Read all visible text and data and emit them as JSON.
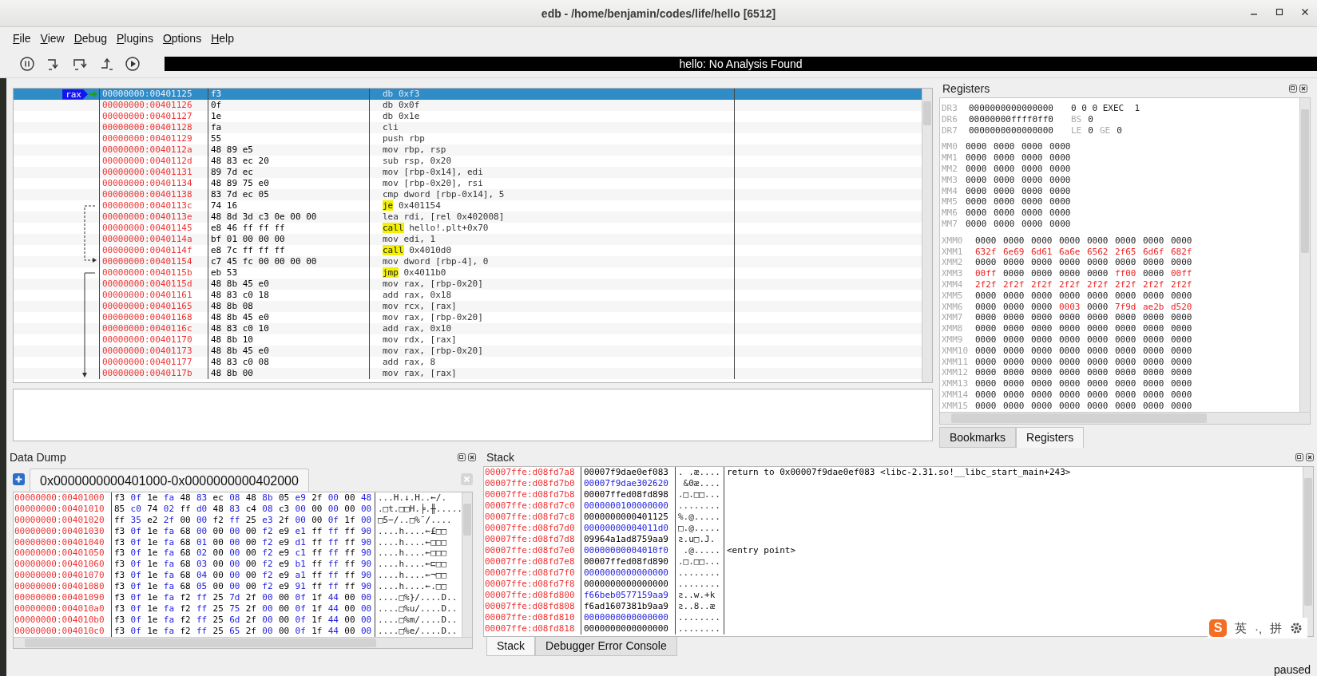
{
  "window": {
    "title": "edb - /home/benjamin/codes/life/hello [6512]"
  },
  "menu": [
    "File",
    "View",
    "Debug",
    "Plugins",
    "Options",
    "Help"
  ],
  "toolbar": {
    "status": "hello: No Analysis Found"
  },
  "disassembly": {
    "rows": [
      {
        "address": "00000000:00401125",
        "bytes": "f3",
        "mnemonic": "db",
        "operands": "0xf3",
        "kind": "data",
        "selected": true,
        "marker": "rax"
      },
      {
        "address": "00000000:00401126",
        "bytes": "0f",
        "mnemonic": "db",
        "operands": "0x0f",
        "kind": "data",
        "selected": false
      },
      {
        "address": "00000000:00401127",
        "bytes": "1e",
        "mnemonic": "db",
        "operands": "0x1e",
        "kind": "data",
        "selected": false
      },
      {
        "address": "00000000:00401128",
        "bytes": "fa",
        "mnemonic": "cli",
        "operands": "",
        "kind": "op",
        "selected": false
      },
      {
        "address": "00000000:00401129",
        "bytes": "55",
        "mnemonic": "push",
        "operands": "rbp",
        "kind": "op",
        "selected": false
      },
      {
        "address": "00000000:0040112a",
        "bytes": "48 89 e5",
        "mnemonic": "mov",
        "operands": "rbp, rsp",
        "kind": "op",
        "selected": false
      },
      {
        "address": "00000000:0040112d",
        "bytes": "48 83 ec 20",
        "mnemonic": "sub",
        "operands": "rsp, 0x20",
        "kind": "op",
        "selected": false
      },
      {
        "address": "00000000:00401131",
        "bytes": "89 7d ec",
        "mnemonic": "mov",
        "operands": "[rbp-0x14], edi",
        "kind": "op",
        "selected": false
      },
      {
        "address": "00000000:00401134",
        "bytes": "48 89 75 e0",
        "mnemonic": "mov",
        "operands": "[rbp-0x20], rsi",
        "kind": "op",
        "selected": false
      },
      {
        "address": "00000000:00401138",
        "bytes": "83 7d ec 05",
        "mnemonic": "cmp",
        "operands": "dword [rbp-0x14], 5",
        "kind": "op",
        "selected": false
      },
      {
        "address": "00000000:0040113c",
        "bytes": "74 16",
        "mnemonic": "je",
        "operands": "0x401154",
        "kind": "branch",
        "selected": false
      },
      {
        "address": "00000000:0040113e",
        "bytes": "48 8d 3d c3 0e 00 00",
        "mnemonic": "lea",
        "operands": "rdi, [rel 0x402008]",
        "kind": "op",
        "selected": false
      },
      {
        "address": "00000000:00401145",
        "bytes": "e8 46 ff ff ff",
        "mnemonic": "call",
        "operands": "hello!.plt+0x70",
        "kind": "branch",
        "selected": false
      },
      {
        "address": "00000000:0040114a",
        "bytes": "bf 01 00 00 00",
        "mnemonic": "mov",
        "operands": "edi, 1",
        "kind": "op",
        "selected": false
      },
      {
        "address": "00000000:0040114f",
        "bytes": "e8 7c ff ff ff",
        "mnemonic": "call",
        "operands": "0x4010d0",
        "kind": "branch",
        "selected": false
      },
      {
        "address": "00000000:00401154",
        "bytes": "c7 45 fc 00 00 00 00",
        "mnemonic": "mov",
        "operands": "dword [rbp-4], 0",
        "kind": "op",
        "selected": false
      },
      {
        "address": "00000000:0040115b",
        "bytes": "eb 53",
        "mnemonic": "jmp",
        "operands": "0x4011b0",
        "kind": "branch",
        "selected": false
      },
      {
        "address": "00000000:0040115d",
        "bytes": "48 8b 45 e0",
        "mnemonic": "mov",
        "operands": "rax, [rbp-0x20]",
        "kind": "op",
        "selected": false
      },
      {
        "address": "00000000:00401161",
        "bytes": "48 83 c0 18",
        "mnemonic": "add",
        "operands": "rax, 0x18",
        "kind": "op",
        "selected": false
      },
      {
        "address": "00000000:00401165",
        "bytes": "48 8b 08",
        "mnemonic": "mov",
        "operands": "rcx, [rax]",
        "kind": "op",
        "selected": false
      },
      {
        "address": "00000000:00401168",
        "bytes": "48 8b 45 e0",
        "mnemonic": "mov",
        "operands": "rax, [rbp-0x20]",
        "kind": "op",
        "selected": false
      },
      {
        "address": "00000000:0040116c",
        "bytes": "48 83 c0 10",
        "mnemonic": "add",
        "operands": "rax, 0x10",
        "kind": "op",
        "selected": false
      },
      {
        "address": "00000000:00401170",
        "bytes": "48 8b 10",
        "mnemonic": "mov",
        "operands": "rdx, [rax]",
        "kind": "op",
        "selected": false
      },
      {
        "address": "00000000:00401173",
        "bytes": "48 8b 45 e0",
        "mnemonic": "mov",
        "operands": "rax, [rbp-0x20]",
        "kind": "op",
        "selected": false
      },
      {
        "address": "00000000:00401177",
        "bytes": "48 83 c0 08",
        "mnemonic": "add",
        "operands": "rax, 8",
        "kind": "op",
        "selected": false
      },
      {
        "address": "00000000:0040117b",
        "bytes": "48 8b 00",
        "mnemonic": "mov",
        "operands": "rax, [rax]",
        "kind": "op",
        "selected": false
      }
    ]
  },
  "registers": {
    "title": "Registers",
    "debug": [
      {
        "name": "DR3",
        "value": "0000000000000000",
        "extra": "0 0 0 EXEC  1"
      },
      {
        "name": "DR6",
        "value": "00000000ffff0ff0",
        "flags": [
          {
            "label": "BS",
            "value": "0"
          }
        ]
      },
      {
        "name": "DR7",
        "value": "0000000000000000",
        "flags": [
          {
            "label": "LE",
            "value": "0"
          },
          {
            "label": "GE",
            "value": "0"
          }
        ]
      }
    ],
    "mmx": [
      {
        "name": "MM0",
        "values": [
          "0000",
          "0000",
          "0000",
          "0000"
        ]
      },
      {
        "name": "MM1",
        "values": [
          "0000",
          "0000",
          "0000",
          "0000"
        ]
      },
      {
        "name": "MM2",
        "values": [
          "0000",
          "0000",
          "0000",
          "0000"
        ]
      },
      {
        "name": "MM3",
        "values": [
          "0000",
          "0000",
          "0000",
          "0000"
        ]
      },
      {
        "name": "MM4",
        "values": [
          "0000",
          "0000",
          "0000",
          "0000"
        ]
      },
      {
        "name": "MM5",
        "values": [
          "0000",
          "0000",
          "0000",
          "0000"
        ]
      },
      {
        "name": "MM6",
        "values": [
          "0000",
          "0000",
          "0000",
          "0000"
        ]
      },
      {
        "name": "MM7",
        "values": [
          "0000",
          "0000",
          "0000",
          "0000"
        ]
      }
    ],
    "xmm": [
      {
        "name": "XMM0",
        "values": [
          "0000",
          "0000",
          "0000",
          "0000",
          "0000",
          "0000",
          "0000",
          "0000"
        ]
      },
      {
        "name": "XMM1",
        "values": [
          "632f",
          "6e69",
          "6d61",
          "6a6e",
          "6562",
          "2f65",
          "6d6f",
          "682f"
        ],
        "changed": [
          true,
          true,
          true,
          true,
          true,
          true,
          true,
          true
        ]
      },
      {
        "name": "XMM2",
        "values": [
          "0000",
          "0000",
          "0000",
          "0000",
          "0000",
          "0000",
          "0000",
          "0000"
        ]
      },
      {
        "name": "XMM3",
        "values": [
          "00ff",
          "0000",
          "0000",
          "0000",
          "0000",
          "ff00",
          "0000",
          "00ff"
        ],
        "changed": [
          true,
          false,
          false,
          false,
          false,
          true,
          false,
          true
        ]
      },
      {
        "name": "XMM4",
        "values": [
          "2f2f",
          "2f2f",
          "2f2f",
          "2f2f",
          "2f2f",
          "2f2f",
          "2f2f",
          "2f2f"
        ],
        "changed": [
          true,
          true,
          true,
          true,
          true,
          true,
          true,
          true
        ]
      },
      {
        "name": "XMM5",
        "values": [
          "0000",
          "0000",
          "0000",
          "0000",
          "0000",
          "0000",
          "0000",
          "0000"
        ]
      },
      {
        "name": "XMM6",
        "values": [
          "0000",
          "0000",
          "0000",
          "0003",
          "0000",
          "7f9d",
          "ae2b",
          "d520"
        ],
        "changed": [
          false,
          false,
          false,
          true,
          false,
          true,
          true,
          true
        ]
      },
      {
        "name": "XMM7",
        "values": [
          "0000",
          "0000",
          "0000",
          "0000",
          "0000",
          "0000",
          "0000",
          "0000"
        ]
      },
      {
        "name": "XMM8",
        "values": [
          "0000",
          "0000",
          "0000",
          "0000",
          "0000",
          "0000",
          "0000",
          "0000"
        ]
      },
      {
        "name": "XMM9",
        "values": [
          "0000",
          "0000",
          "0000",
          "0000",
          "0000",
          "0000",
          "0000",
          "0000"
        ]
      },
      {
        "name": "XMM10",
        "values": [
          "0000",
          "0000",
          "0000",
          "0000",
          "0000",
          "0000",
          "0000",
          "0000"
        ]
      },
      {
        "name": "XMM11",
        "values": [
          "0000",
          "0000",
          "0000",
          "0000",
          "0000",
          "0000",
          "0000",
          "0000"
        ]
      },
      {
        "name": "XMM12",
        "values": [
          "0000",
          "0000",
          "0000",
          "0000",
          "0000",
          "0000",
          "0000",
          "0000"
        ]
      },
      {
        "name": "XMM13",
        "values": [
          "0000",
          "0000",
          "0000",
          "0000",
          "0000",
          "0000",
          "0000",
          "0000"
        ]
      },
      {
        "name": "XMM14",
        "values": [
          "0000",
          "0000",
          "0000",
          "0000",
          "0000",
          "0000",
          "0000",
          "0000"
        ]
      },
      {
        "name": "XMM15",
        "values": [
          "0000",
          "0000",
          "0000",
          "0000",
          "0000",
          "0000",
          "0000",
          "0000"
        ]
      }
    ],
    "tabs": [
      {
        "label": "Bookmarks",
        "selected": false
      },
      {
        "label": "Registers",
        "selected": true
      }
    ]
  },
  "data_dump": {
    "title": "Data Dump",
    "tab": "0x0000000000401000-0x0000000000402000",
    "rows": [
      {
        "address": "00000000:00401000",
        "bytes": "f3 0f 1e fa 48 83 ec 08 48 8b 05 e9 2f 00 00 48",
        "ascii": "...H.↓.H..←/."
      },
      {
        "address": "00000000:00401010",
        "bytes": "85 c0 74 02 ff d0 48 83 c4 08 c3 00 00 00 00 00",
        "ascii": ".□t.□□H.╞.╫....."
      },
      {
        "address": "00000000:00401020",
        "bytes": "ff 35 e2 2f 00 00 f2 ff 25 e3 2f 00 00 0f 1f 00",
        "ascii": "□5−/..□%¯/...."
      },
      {
        "address": "00000000:00401030",
        "bytes": "f3 0f 1e fa 68 00 00 00 00 f2 e9 e1 ff ff ff 90",
        "ascii": "....h....←£□□"
      },
      {
        "address": "00000000:00401040",
        "bytes": "f3 0f 1e fa 68 01 00 00 00 f2 e9 d1 ff ff ff 90",
        "ascii": "....h....←□□□"
      },
      {
        "address": "00000000:00401050",
        "bytes": "f3 0f 1e fa 68 02 00 00 00 f2 e9 c1 ff ff ff 90",
        "ascii": "....h....←□□□"
      },
      {
        "address": "00000000:00401060",
        "bytes": "f3 0f 1e fa 68 03 00 00 00 f2 e9 b1 ff ff ff 90",
        "ascii": "....h....←⊏□□"
      },
      {
        "address": "00000000:00401070",
        "bytes": "f3 0f 1e fa 68 04 00 00 00 f2 e9 a1 ff ff ff 90",
        "ascii": "....h....←¬□□"
      },
      {
        "address": "00000000:00401080",
        "bytes": "f3 0f 1e fa 68 05 00 00 00 f2 e9 91 ff ff ff 90",
        "ascii": "....h....←.□□"
      },
      {
        "address": "00000000:00401090",
        "bytes": "f3 0f 1e fa f2 ff 25 7d 2f 00 00 0f 1f 44 00 00",
        "ascii": "....□%}/....D.."
      },
      {
        "address": "00000000:004010a0",
        "bytes": "f3 0f 1e fa f2 ff 25 75 2f 00 00 0f 1f 44 00 00",
        "ascii": "....□%u/....D.."
      },
      {
        "address": "00000000:004010b0",
        "bytes": "f3 0f 1e fa f2 ff 25 6d 2f 00 00 0f 1f 44 00 00",
        "ascii": "....□%m/....D.."
      },
      {
        "address": "00000000:004010c0",
        "bytes": "f3 0f 1e fa f2 ff 25 65 2f 00 00 0f 1f 44 00 00",
        "ascii": "....□%e/....D.."
      }
    ]
  },
  "stack": {
    "title": "Stack",
    "rows": [
      {
        "address": "00007ffe:d08fd7a8",
        "value": "00007f9dae0ef083",
        "ascii": ". .æ....",
        "comment": "return to 0x00007f9dae0ef083 <libc-2.31.so!__libc_start_main+243>"
      },
      {
        "address": "00007ffe:d08fd7b0",
        "value": "00007f9dae302620",
        "ascii": " &0æ...."
      },
      {
        "address": "00007ffe:d08fd7b8",
        "value": "00007ffed08fd898",
        "ascii": ".□.□□..."
      },
      {
        "address": "00007ffe:d08fd7c0",
        "value": "0000000100000000",
        "ascii": "........"
      },
      {
        "address": "00007ffe:d08fd7c8",
        "value": "0000000000401125",
        "ascii": "%.@....."
      },
      {
        "address": "00007ffe:d08fd7d0",
        "value": "00000000004011d0",
        "ascii": "□.@....."
      },
      {
        "address": "00007ffe:d08fd7d8",
        "value": "09964a1ad8759aa9",
        "ascii": "ƨ.u□.J."
      },
      {
        "address": "00007ffe:d08fd7e0",
        "value": "00000000004010f0",
        "ascii": " .@.....",
        "comment": "<entry point>"
      },
      {
        "address": "00007ffe:d08fd7e8",
        "value": "00007ffed08fd890",
        "ascii": ".□.□□..."
      },
      {
        "address": "00007ffe:d08fd7f0",
        "value": "0000000000000000",
        "ascii": "........"
      },
      {
        "address": "00007ffe:d08fd7f8",
        "value": "0000000000000000",
        "ascii": "........"
      },
      {
        "address": "00007ffe:d08fd800",
        "value": "f66beb0577159aa9",
        "ascii": "ƨ..w.+k"
      },
      {
        "address": "00007ffe:d08fd808",
        "value": "f6ad1607381b9aa9",
        "ascii": "ƨ..8..æ"
      },
      {
        "address": "00007ffe:d08fd810",
        "value": "0000000000000000",
        "ascii": "........"
      },
      {
        "address": "00007ffe:d08fd818",
        "value": "0000000000000000",
        "ascii": "........"
      }
    ],
    "tabs": [
      {
        "label": "Stack",
        "selected": true
      },
      {
        "label": "Debugger Error Console",
        "selected": false
      }
    ]
  },
  "input_method": {
    "logo": "S",
    "items": [
      "英",
      "·,",
      "拼"
    ]
  },
  "status_bar": {
    "text": "paused"
  }
}
